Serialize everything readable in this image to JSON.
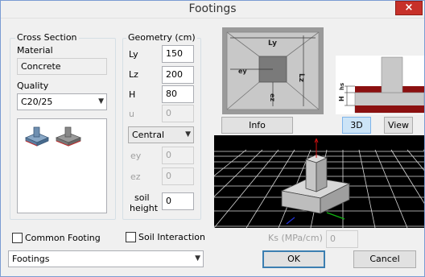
{
  "window": {
    "title": "Footings",
    "close_glyph": "×"
  },
  "cross_section": {
    "legend": "Cross Section",
    "material_label": "Material",
    "material_value": "Concrete",
    "quality_label": "Quality",
    "quality_value": "C20/25"
  },
  "geometry": {
    "legend": "Geometry (cm)",
    "ly_label": "Ly",
    "ly_value": "150",
    "lz_label": "Lz",
    "lz_value": "200",
    "h_label": "H",
    "h_value": "80",
    "u_label": "u",
    "u_value": "0",
    "position_value": "Central",
    "ey_label": "ey",
    "ey_value": "0",
    "ez_label": "ez",
    "ez_value": "0",
    "soil_label_1": "soil",
    "soil_label_2": "height",
    "soil_value": "0"
  },
  "diagram_labels": {
    "ly": "Ly",
    "lz": "Lz",
    "ey": "ey",
    "ez": "ez",
    "hs": "hs",
    "h": "H"
  },
  "buttons": {
    "info": "Info",
    "three_d": "3D",
    "view": "View",
    "ok": "OK",
    "cancel": "Cancel"
  },
  "options": {
    "common_footing": "Common Footing",
    "soil_interaction": "Soil Interaction",
    "ks_label": "Ks (MPa/cm)",
    "ks_value": "0",
    "type_value": "Footings"
  },
  "colors": {
    "title_bar_close": "#c7312a",
    "viewport_bg": "#000000",
    "grid": "#ffffff",
    "section_red": "#8b1010"
  }
}
